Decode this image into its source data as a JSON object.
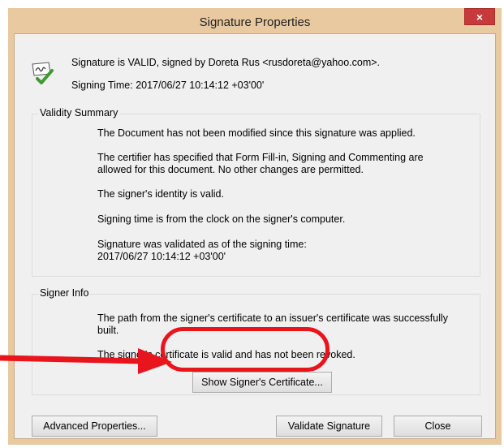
{
  "window": {
    "title": "Signature Properties",
    "close_glyph": "×"
  },
  "signature": {
    "status_line": "Signature is VALID, signed by Doreta Rus <rusdoreta@yahoo.com>.",
    "signing_time": "Signing Time:  2017/06/27 10:14:12 +03'00'",
    "icon": "signature-valid-icon"
  },
  "validity_summary": {
    "label": "Validity Summary",
    "items": [
      "The Document has not been modified since this signature was applied.",
      "The certifier has specified that Form Fill-in, Signing and Commenting are allowed for this document. No other changes are permitted.",
      "The signer's identity is valid.",
      "Signing time is from the clock on the signer's computer.",
      "Signature was validated as of the signing time:\n2017/06/27 10:14:12 +03'00'"
    ]
  },
  "signer_info": {
    "label": "Signer Info",
    "items": [
      "The path from the signer's certificate to an issuer's certificate was successfully built.",
      "The signer's certificate is valid and has not been revoked."
    ],
    "show_certificate_label": "Show Signer's Certificate..."
  },
  "buttons": {
    "advanced": "Advanced Properties...",
    "validate": "Validate Signature",
    "close": "Close"
  },
  "colors": {
    "annotation": "#e8161c",
    "frame": "#e9c99f",
    "close_button": "#c7393a"
  }
}
